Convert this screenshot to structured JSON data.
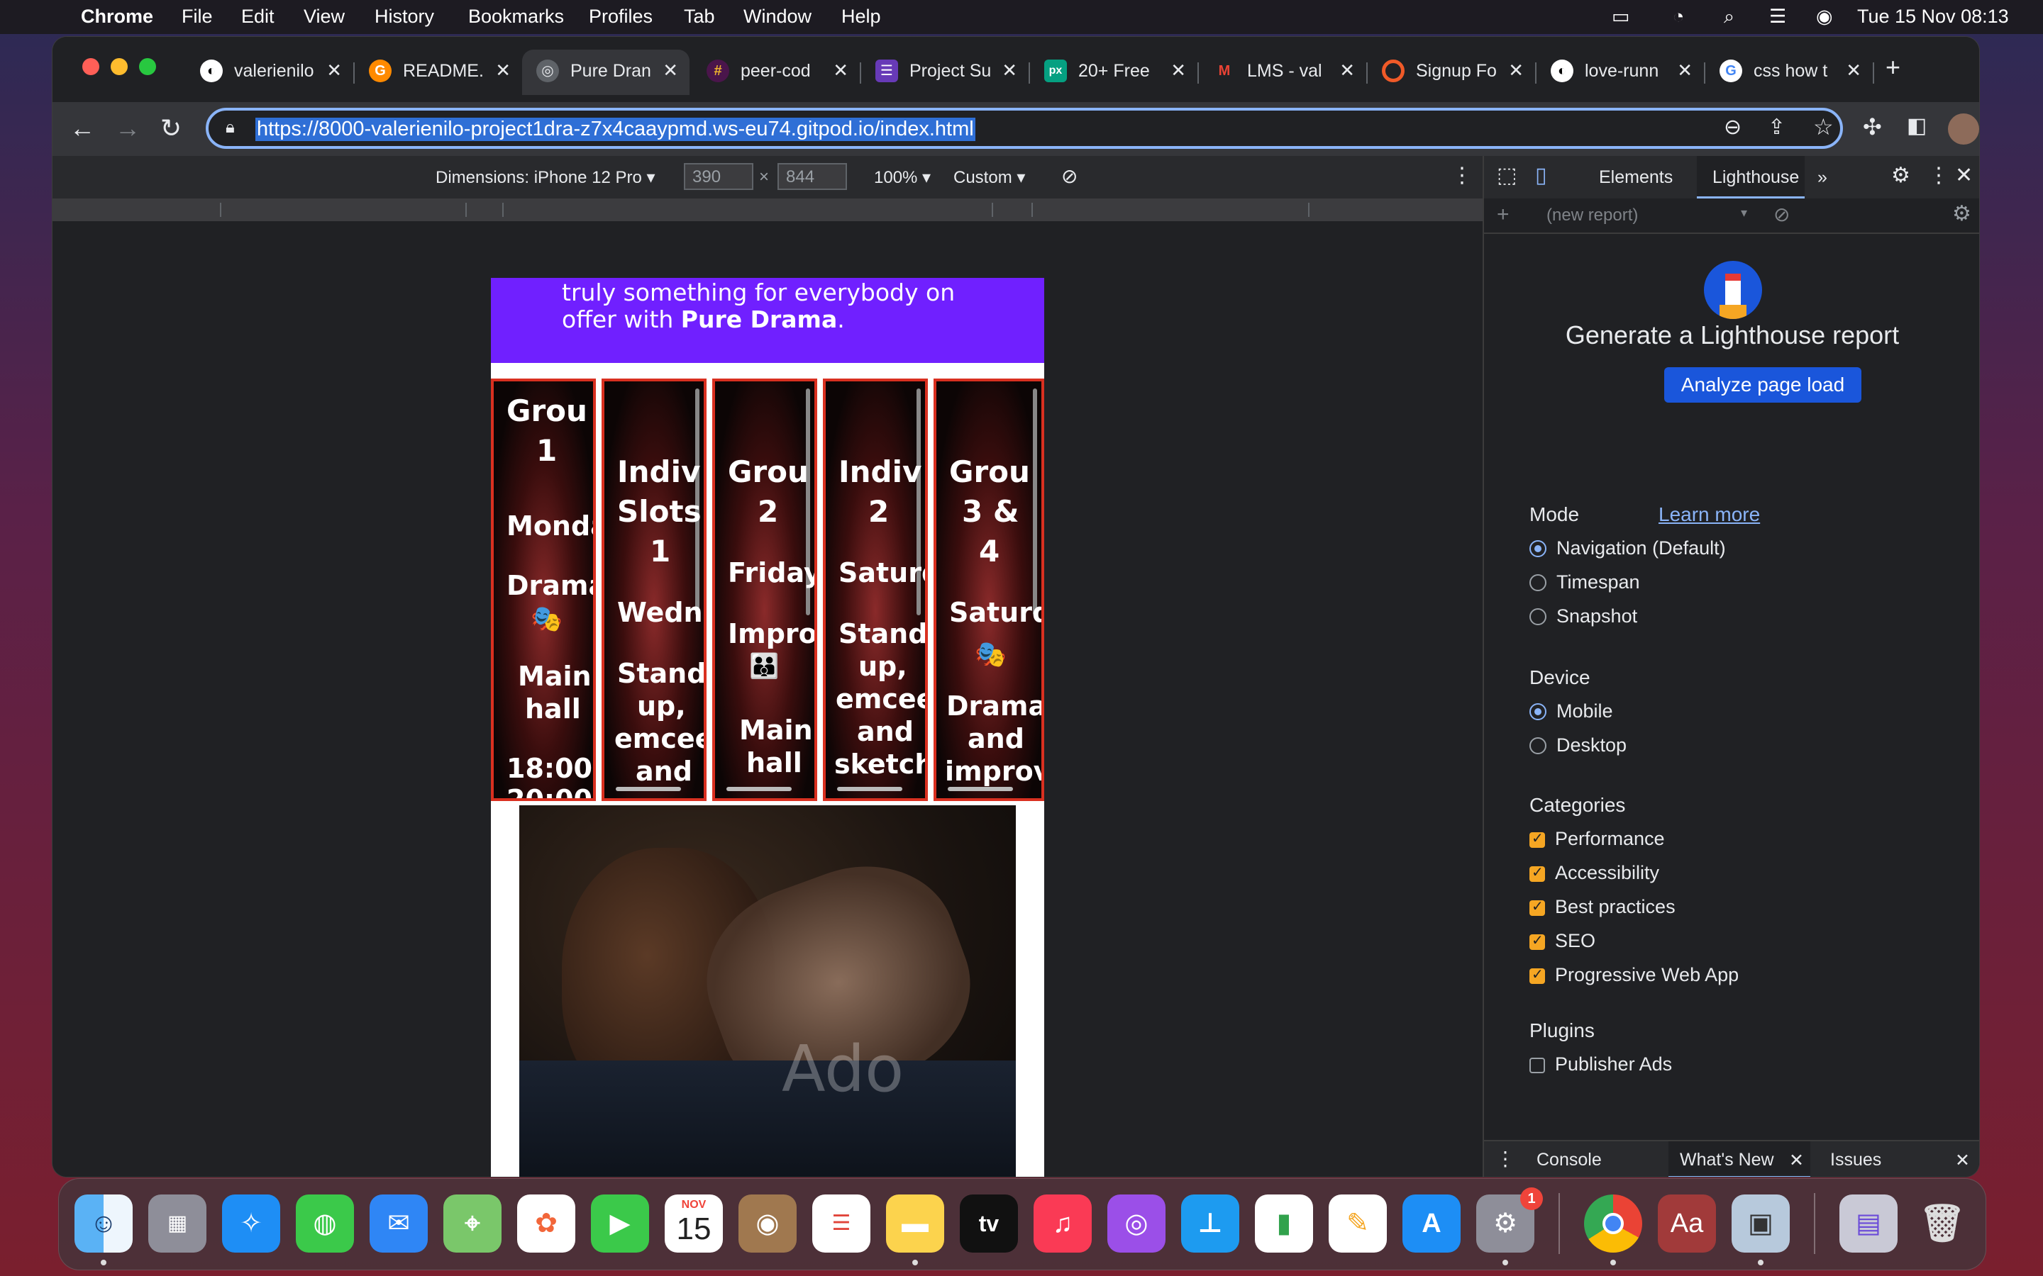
{
  "menubar": {
    "app": "Chrome",
    "items": [
      "File",
      "Edit",
      "View",
      "History",
      "Bookmarks",
      "Profiles",
      "Tab",
      "Window",
      "Help"
    ],
    "clock": "Tue 15 Nov  08:13"
  },
  "tabs": [
    {
      "label": "valerienilo",
      "icon": "github-icon",
      "active": false
    },
    {
      "label": "README.",
      "icon": "gitpod-icon",
      "active": false
    },
    {
      "label": "Pure Dran",
      "icon": "globe-icon",
      "active": true
    },
    {
      "label": "peer-cod",
      "icon": "slack-icon",
      "active": false
    },
    {
      "label": "Project Su",
      "icon": "form-icon",
      "active": false
    },
    {
      "label": "20+ Free",
      "icon": "pexels-icon",
      "active": false
    },
    {
      "label": "LMS - val",
      "icon": "gmail-icon",
      "active": false
    },
    {
      "label": "Signup Fo",
      "icon": "ring-icon",
      "active": false
    },
    {
      "label": "love-runn",
      "icon": "github-icon",
      "active": false
    },
    {
      "label": "css how t",
      "icon": "google-icon",
      "active": false
    }
  ],
  "address": {
    "url": "https://8000-valerienilo-project1dra-z7x4caaypmd.ws-eu74.gitpod.io/index.html"
  },
  "device_toolbar": {
    "dimensions_label": "Dimensions: iPhone 12 Pro ▾",
    "width": "390",
    "times": "×",
    "height": "844",
    "zoom": "100% ▾",
    "throttle": "Custom ▾"
  },
  "page": {
    "hero_line1": "truly something for everybody on",
    "hero_line2_prefix": "offer with ",
    "hero_line2_bold": "Pure Drama",
    "hero_line2_suffix": ".",
    "cards": [
      {
        "lines": [
          "Grou",
          "1",
          "Monda",
          "Drama",
          "🎭",
          "Main",
          "hall",
          "18:00-",
          "20:00"
        ]
      },
      {
        "lines": [
          "",
          "Indiv",
          "Slots",
          "1",
          "Wedne",
          "Stand",
          "up,",
          "emcee",
          "and"
        ]
      },
      {
        "lines": [
          "",
          "Grou",
          "2",
          "Friday",
          "Impro",
          "👪",
          "Main",
          "hall",
          ""
        ]
      },
      {
        "lines": [
          "",
          "Indiv",
          "2",
          "Saturd",
          "Stand",
          "up,",
          "emcee",
          "and",
          "sketch"
        ]
      },
      {
        "lines": [
          "",
          "Grou",
          "3 &",
          "4",
          "Saturd",
          "🎭",
          "Drama",
          "and",
          "improv"
        ]
      }
    ],
    "watermark": "Ado"
  },
  "devtools": {
    "tabs": [
      "Elements",
      "Lighthouse"
    ],
    "active_tab": "Lighthouse",
    "report_placeholder": "(new report)",
    "title": "Generate a Lighthouse report",
    "analyze_button": "Analyze page load",
    "mode_label": "Mode",
    "learn_more": "Learn more",
    "modes": [
      {
        "label": "Navigation (Default)",
        "selected": true
      },
      {
        "label": "Timespan",
        "selected": false
      },
      {
        "label": "Snapshot",
        "selected": false
      }
    ],
    "device_label": "Device",
    "devices": [
      {
        "label": "Mobile",
        "selected": true
      },
      {
        "label": "Desktop",
        "selected": false
      }
    ],
    "categories_label": "Categories",
    "categories": [
      {
        "label": "Performance",
        "checked": true
      },
      {
        "label": "Accessibility",
        "checked": true
      },
      {
        "label": "Best practices",
        "checked": true
      },
      {
        "label": "SEO",
        "checked": true
      },
      {
        "label": "Progressive Web App",
        "checked": true
      }
    ],
    "plugins_label": "Plugins",
    "plugins": [
      {
        "label": "Publisher Ads",
        "checked": false
      }
    ],
    "drawer_tabs": [
      "Console",
      "What's New",
      "Issues"
    ],
    "active_drawer_tab": "What's New"
  },
  "dock": {
    "calendar_month": "NOV",
    "calendar_day": "15",
    "settings_badge": "1",
    "appletv_label": "tv",
    "dict_label": "Aa"
  },
  "colors": {
    "hero_purple": "#7020ff",
    "card_border": "#d93020",
    "lighthouse_button": "#1a56db",
    "checkbox": "#f5a623",
    "link": "#8ab4f8"
  }
}
